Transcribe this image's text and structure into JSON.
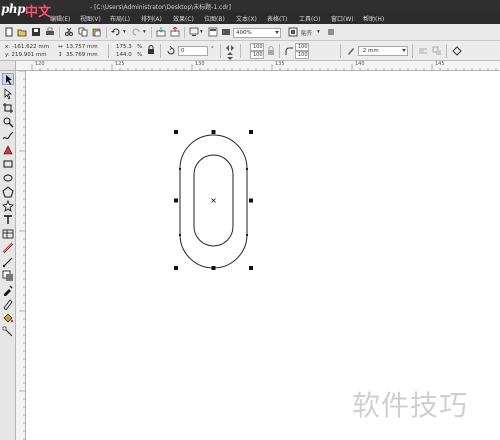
{
  "logo": {
    "php": "php",
    "cn": "中文网"
  },
  "titlebar": {
    "title": "- [C:\\Users\\Administrator\\Desktop\\未标题-1.cdr]"
  },
  "menu": {
    "items": [
      "编辑(E)",
      "视图(V)",
      "布局(L)",
      "排列(A)",
      "效果(C)",
      "位图(B)",
      "文本(X)",
      "表格(T)",
      "工具(O)",
      "窗口(W)",
      "帮助(H)"
    ]
  },
  "toolbar1": {
    "zoom_value": "400%",
    "snap_label": "贴齐"
  },
  "toolbar2": {
    "x_value": "x: -161.622 mm",
    "y_value": "y: 219.901 mm",
    "width_value": "13.757 mm",
    "height_value": "35.769 mm",
    "scale_x": "175.3",
    "scale_y": "144.0",
    "percent": "%",
    "rotation": "0",
    "corner_tl": "100",
    "corner_bl": "100",
    "corner_tr": "100",
    "corner_br": "100",
    "outline_width": ".2 mm"
  },
  "ruler_top": {
    "labels": [
      "120",
      "125",
      "130",
      "135",
      "140",
      "145"
    ]
  },
  "canvas": {
    "shape": "rounded rectangle (stadium) with inner stadium contour, selected"
  },
  "watermark": {
    "text": "软件技巧"
  },
  "colors": {
    "titlebar": "#2f2f2f",
    "menubar": "#2b2b2b",
    "toolbar": "#ececec",
    "canvas": "#ffffff",
    "logo_cn": "#ff4e6a"
  }
}
